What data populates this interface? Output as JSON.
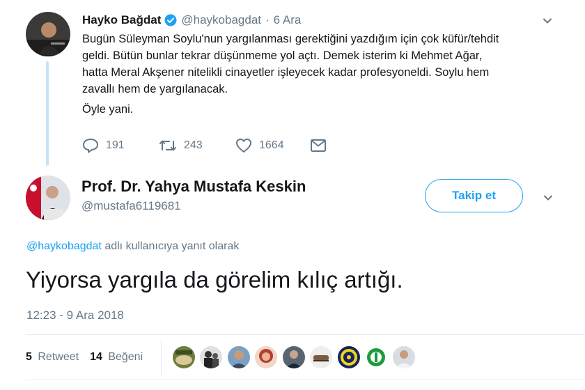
{
  "parent_tweet": {
    "author_name": "Hayko Bağdat",
    "verified_icon": "verified-badge-icon",
    "handle": "@haykobagdat",
    "separator": "·",
    "date": "6 Ara",
    "lines": [
      "Bugün Süleyman Soylu'nun yargılanması gerektiğini yazdığım için çok küfür/tehdit",
      "geldi. Bütün bunlar tekrar düşünmeme yol açtı. Demek isterim ki Mehmet Ağar,",
      "hatta Meral Akşener nitelikli cinayetler işleyecek kadar profesyoneldi. Soylu hem",
      "zavallı hem de yargılanacak.",
      "Öyle yani."
    ],
    "actions": {
      "replies": "191",
      "retweets": "243",
      "likes": "1664"
    }
  },
  "reply_tweet": {
    "author_name": "Prof. Dr. Yahya Mustafa Keskin",
    "handle": "@mustafa6119681",
    "follow_label": "Takip et",
    "reply_to_handle": "@haykobagdat",
    "reply_to_suffix": " adlı kullanıcıya yanıt olarak",
    "text": "Yiyorsa yargıla da görelim kılıç artığı.",
    "timestamp": "12:23 - 9 Ara 2018",
    "stats": {
      "retweet_count": "5",
      "retweet_label": "Retweet",
      "like_count": "14",
      "like_label": "Beğeni"
    }
  },
  "colors": {
    "accent": "#1da1f2",
    "muted": "#657786",
    "thread_line": "#c7e3f5",
    "divider": "#e6ecf0"
  }
}
